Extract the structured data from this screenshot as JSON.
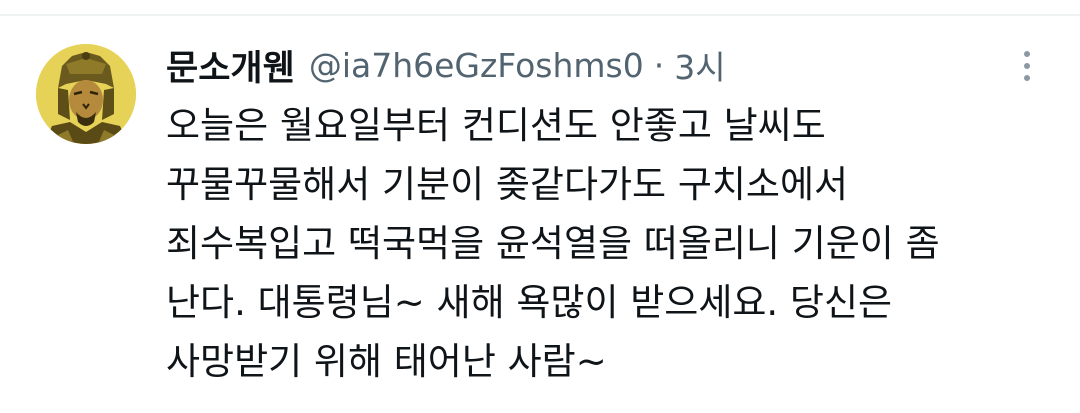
{
  "tweet": {
    "display_name": "문소개웬",
    "handle": "@ia7h6eGzFoshms0",
    "separator": "·",
    "time": "3시",
    "text_lines": [
      "오늘은 월요일부터 컨디션도 안좋고 날씨도",
      "꾸물꾸물해서 기분이 좆같다가도 구치소에서",
      "죄수복입고 떡국먹을 윤석열을 떠올리니 기운이 좀",
      "난다. 대통령님~  새해 욕많이 받으세요. 당신은",
      "사망받기 위해 태어난 사람~"
    ]
  },
  "icons": {
    "avatar": "warrior-portrait-avatar",
    "more": "more-vertical-icon"
  },
  "colors": {
    "text_primary": "#0f1419",
    "text_secondary": "#536471",
    "avatar_background": "#e8d45a",
    "divider": "#eff3f4"
  }
}
